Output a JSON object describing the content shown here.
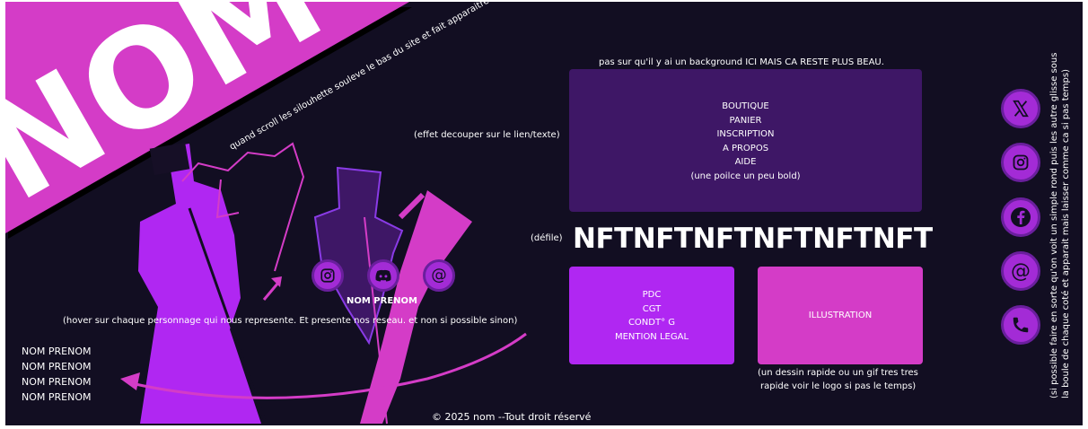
{
  "hero": {
    "title": "NOM",
    "scroll_note": "quand scroll les  silouhette souleve le bas du site et fait apparaitre le footer"
  },
  "menu": {
    "top_note": "pas sur qu'il y ai un background  ICI MAIS CA RESTE PLUS BEAU.",
    "side_note": "(effet decouper sur le lien/texte)",
    "items": [
      "BOUTIQUE",
      "PANIER",
      "INSCRIPTION",
      "A PROPOS",
      "AIDE"
    ],
    "footnote": "(une poilce un peu bold)"
  },
  "ticker": {
    "label": "(défile)",
    "text": "NFTNFTNFTNFTNFTNFT"
  },
  "legal": {
    "items": [
      "PDC",
      "CGT",
      "CONDT° G",
      "MENTION LEGAL"
    ]
  },
  "illustration": {
    "label": "ILLUSTRATION",
    "note_line1": "(un dessin rapide ou un gif tres tres",
    "note_line2": "rapide voir le logo si pas le temps)"
  },
  "people": {
    "name_label": "NOM PRENOM",
    "hover_note": "(hover sur chaque personnage qui nous represente. Et presente nos reseau. et non si possible  sinon)",
    "list": [
      "NOM PRENOM",
      "NOM PRENOM",
      "NOM PRENOM",
      "NOM PRENOM"
    ],
    "social_icons": [
      "instagram-icon",
      "discord-icon",
      "at-icon"
    ]
  },
  "right_social": {
    "icons": [
      "x-icon",
      "instagram-icon",
      "facebook-icon",
      "at-icon",
      "phone-icon"
    ],
    "note_line1": "(si possible faire en sorte qu'on voit un simple rond puis les autre glisse sous",
    "note_line2": "la boule de chaque coté et apparait   mais laisser comme ca si pas temps)"
  },
  "footer": {
    "copyright": "© 2025  nom --Tout droit réservé"
  },
  "colors": {
    "background": "#120e22",
    "magenta": "#d43cc7",
    "purple": "#b027f2",
    "dark_purple": "#3e1766",
    "icon_circle": "#a32bd6"
  }
}
